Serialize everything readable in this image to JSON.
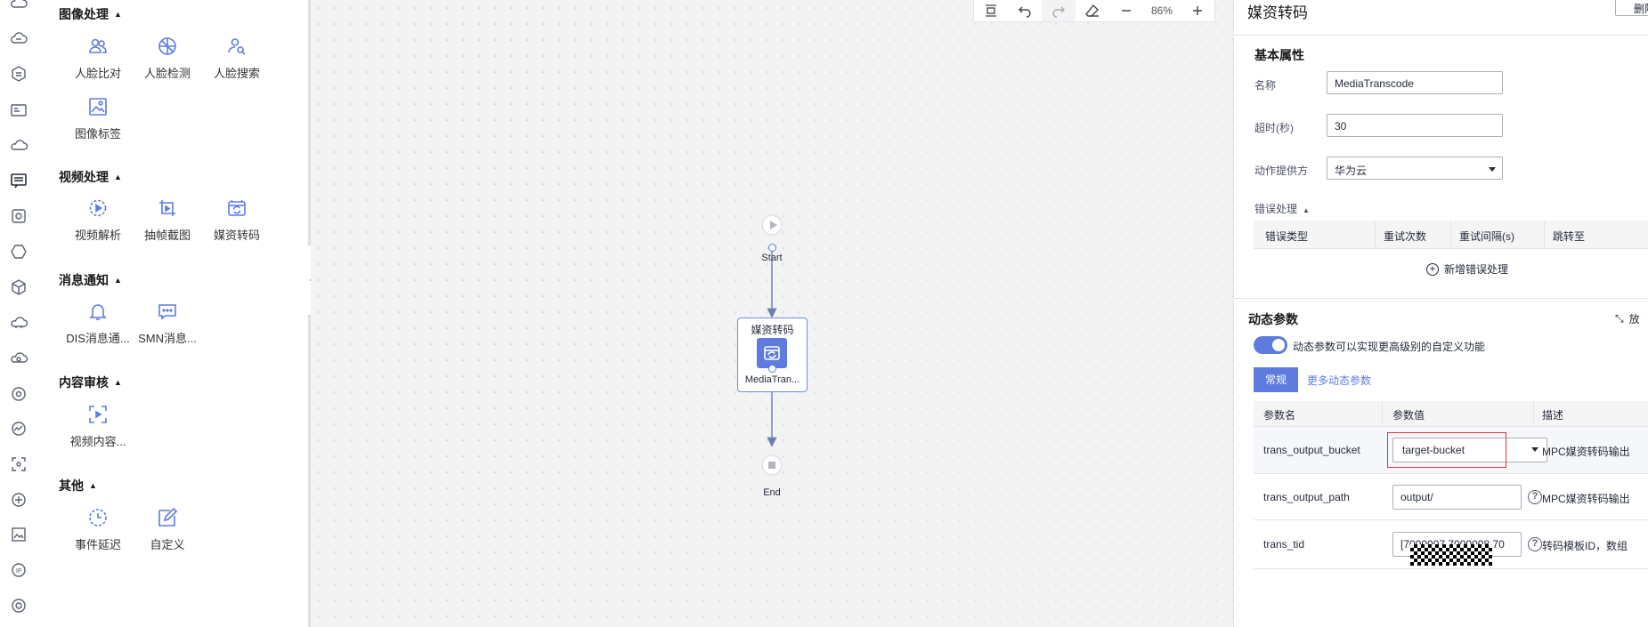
{
  "palette": {
    "sections": {
      "image": {
        "title": "图像处理",
        "items": [
          "人脸比对",
          "人脸检测",
          "人脸搜索",
          "图像标签"
        ]
      },
      "video": {
        "title": "视频处理",
        "items": [
          "视频解析",
          "抽帧截图",
          "媒资转码"
        ]
      },
      "message": {
        "title": "消息通知",
        "items": [
          "DIS消息通...",
          "SMN消息..."
        ]
      },
      "audit": {
        "title": "内容审核",
        "items": [
          "视频内容..."
        ]
      },
      "other": {
        "title": "其他",
        "items": [
          "事件延迟",
          "自定义"
        ]
      }
    }
  },
  "toolbar": {
    "zoom": "86%"
  },
  "flow": {
    "start_label": "Start",
    "end_label": "End",
    "task": {
      "title": "媒资转码",
      "name": "MediaTran..."
    }
  },
  "props": {
    "title": "媒资转码",
    "delete_button": "删除",
    "basic": {
      "heading": "基本属性",
      "name_label": "名称",
      "name_value": "MediaTranscode",
      "timeout_label": "超时(秒)",
      "timeout_value": "30",
      "provider_label": "动作提供方",
      "provider_value": "华为云"
    },
    "error": {
      "heading": "错误处理",
      "columns": [
        "错误类型",
        "重试次数",
        "重试间隔(s)",
        "跳转至"
      ],
      "add_label": "新增错误处理"
    },
    "dynamic": {
      "heading": "动态参数",
      "expand_label": "放",
      "toggle_desc": "动态参数可以实现更高级别的自定义功能",
      "toggle_on": true,
      "tab_normal": "常规",
      "tab_more": "更多动态参数",
      "columns": [
        "参数名",
        "参数值",
        "描述"
      ],
      "rows": [
        {
          "name": "trans_output_bucket",
          "value": "target-bucket",
          "desc": "MPC媒资转码输出"
        },
        {
          "name": "trans_output_path",
          "value": "output/",
          "desc": "MPC媒资转码输出"
        },
        {
          "name": "trans_tid",
          "value": "[7000007,7000008,70",
          "desc": "转码模板ID，数组"
        }
      ]
    }
  },
  "colors": {
    "accent": "#5e7ce0",
    "highlight": "#e8303a",
    "panel_bg": "#ffffff",
    "canvas_bg": "#f3f3f4"
  }
}
